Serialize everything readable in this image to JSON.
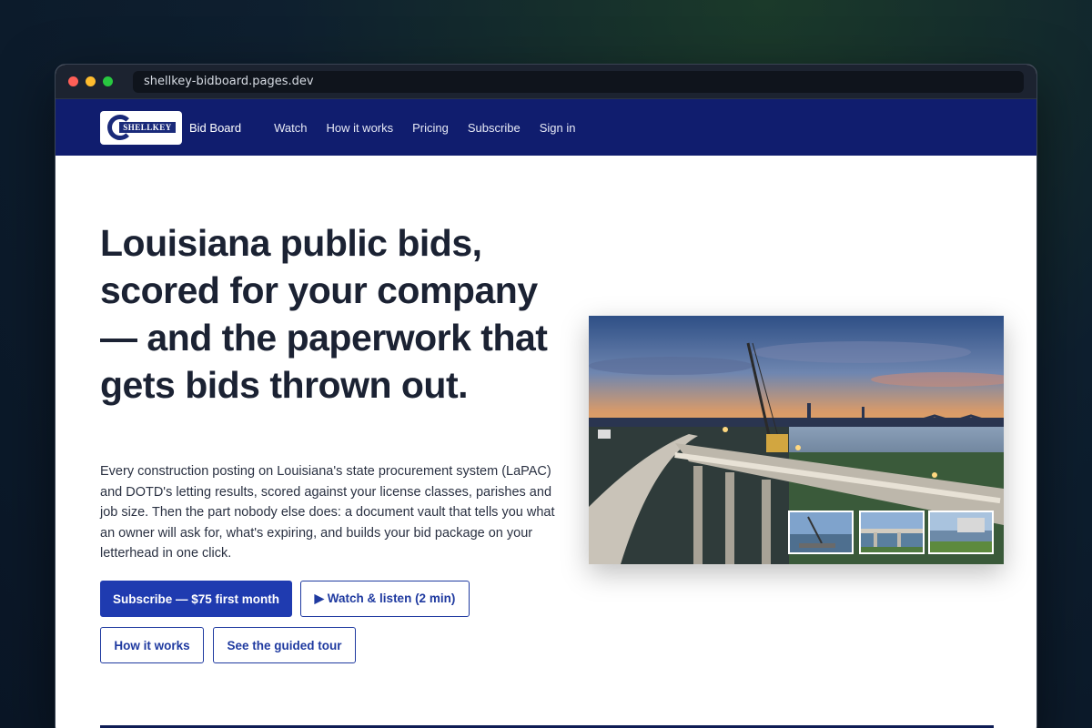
{
  "browser": {
    "url": "shellkey-bidboard.pages.dev"
  },
  "nav": {
    "logo_text": "SHELLKEY",
    "brand": "Bid Board",
    "links": [
      "Watch",
      "How it works",
      "Pricing",
      "Subscribe",
      "Sign in"
    ]
  },
  "hero": {
    "headline": "Louisiana public bids, scored for your company — and the paperwork that gets bids thrown out.",
    "lede": "Every construction posting on Louisiana's state procurement system (LaPAC) and DOTD's letting results, scored against your license classes, parishes and job size. Then the part nobody else does: a document vault that tells you what an owner will ask for, what's expiring, and builds your bid package on your letterhead in one click.",
    "buttons": {
      "subscribe": "Subscribe — $75 first month",
      "watch": "▶ Watch & listen (2 min)",
      "how": "How it works",
      "tour": "See the guided tour"
    }
  },
  "colors": {
    "nav_bg": "#101d6e",
    "primary": "#1f3bb0",
    "text": "#1b2233"
  }
}
